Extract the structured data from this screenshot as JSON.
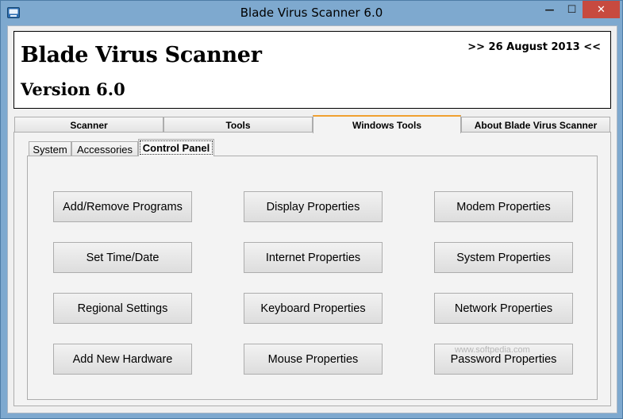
{
  "window": {
    "title": "Blade Virus Scanner 6.0",
    "minimize_glyph": "—",
    "maximize_glyph": "☐",
    "close_glyph": "✕",
    "close_color": "#c74a3f"
  },
  "header": {
    "app_name": "Blade Virus Scanner",
    "version": "Version 6.0",
    "date": ">> 26 August 2013 <<"
  },
  "main_tabs": [
    {
      "label": "Scanner",
      "active": false
    },
    {
      "label": "Tools",
      "active": false
    },
    {
      "label": "Windows Tools",
      "active": true
    },
    {
      "label": "About Blade Virus Scanner",
      "active": false
    }
  ],
  "sub_tabs": [
    {
      "label": "System",
      "active": false
    },
    {
      "label": "Accessories",
      "active": false
    },
    {
      "label": "Control Panel",
      "active": true
    }
  ],
  "buttons": [
    {
      "label": "Add/Remove Programs"
    },
    {
      "label": "Display Properties"
    },
    {
      "label": "Modem Properties"
    },
    {
      "label": "Set Time/Date"
    },
    {
      "label": "Internet Properties"
    },
    {
      "label": "System Properties"
    },
    {
      "label": "Regional Settings"
    },
    {
      "label": "Keyboard Properties"
    },
    {
      "label": "Network Properties"
    },
    {
      "label": "Add New Hardware"
    },
    {
      "label": "Mouse Properties"
    },
    {
      "label": "Password Properties"
    }
  ],
  "watermark": "www.softpedia.com",
  "accent_color": "#f0a030"
}
